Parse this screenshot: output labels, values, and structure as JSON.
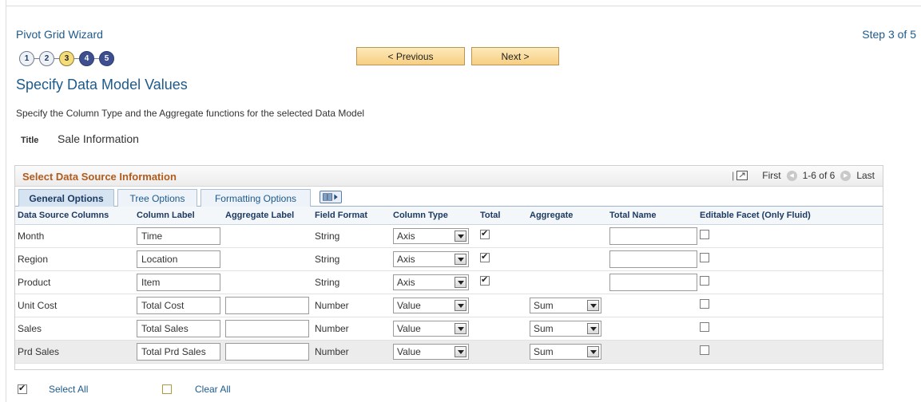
{
  "wizard": {
    "title": "Pivot Grid Wizard",
    "step_indicator": "Step 3 of 5",
    "steps": [
      "1",
      "2",
      "3",
      "4",
      "5"
    ],
    "current_step": 3,
    "prev_label": "< Previous",
    "next_label": "Next >"
  },
  "page": {
    "title": "Specify Data Model Values",
    "instructions": "Specify the Column Type and the Aggregate functions for the selected Data Model",
    "title_label": "Title",
    "title_value": "Sale Information"
  },
  "grid": {
    "title": "Select Data Source Information",
    "nav": {
      "first": "First",
      "range": "1-6 of 6",
      "last": "Last"
    },
    "tabs": [
      "General Options",
      "Tree Options",
      "Formatting Options"
    ],
    "active_tab": "General Options",
    "columns": [
      "Data Source Columns",
      "Column Label",
      "Aggregate Label",
      "Field Format",
      "Column Type",
      "Total",
      "Aggregate",
      "Total Name",
      "Editable Facet (Only Fluid)"
    ],
    "rows": [
      {
        "source": "Month",
        "label": "Time",
        "agg_label": null,
        "format": "String",
        "type": "Axis",
        "total": true,
        "aggregate": null,
        "total_name": "",
        "editable": false
      },
      {
        "source": "Region",
        "label": "Location",
        "agg_label": null,
        "format": "String",
        "type": "Axis",
        "total": true,
        "aggregate": null,
        "total_name": "",
        "editable": false
      },
      {
        "source": "Product",
        "label": "Item",
        "agg_label": null,
        "format": "String",
        "type": "Axis",
        "total": true,
        "aggregate": null,
        "total_name": "",
        "editable": false
      },
      {
        "source": "Unit Cost",
        "label": "Total Cost",
        "agg_label": "",
        "format": "Number",
        "type": "Value",
        "total": null,
        "aggregate": "Sum",
        "total_name": null,
        "editable": false
      },
      {
        "source": "Sales",
        "label": "Total Sales",
        "agg_label": "",
        "format": "Number",
        "type": "Value",
        "total": null,
        "aggregate": "Sum",
        "total_name": null,
        "editable": false
      },
      {
        "source": "Prd Sales",
        "label": "Total Prd Sales",
        "agg_label": "",
        "format": "Number",
        "type": "Value",
        "total": null,
        "aggregate": "Sum",
        "total_name": null,
        "editable": false
      }
    ]
  },
  "footer": {
    "select_all": "Select All",
    "clear_all": "Clear All"
  }
}
